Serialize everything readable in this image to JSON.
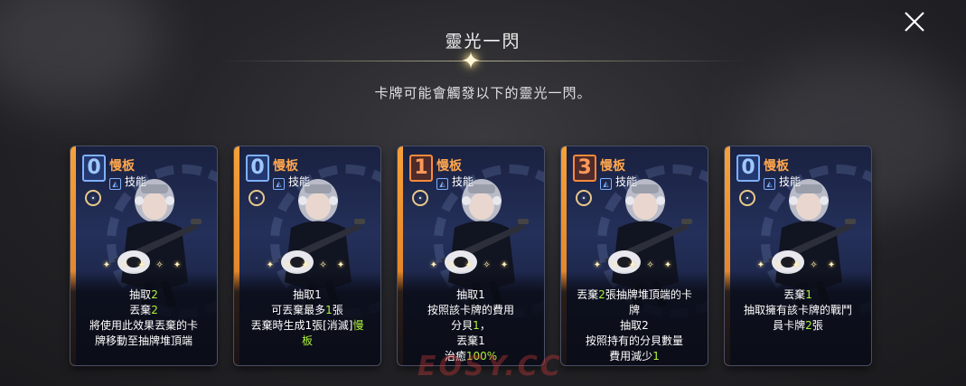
{
  "header": {
    "title": "靈光一閃",
    "subtitle": "卡牌可能會觸發以下的靈光一閃。"
  },
  "watermark": "EOSY.CC",
  "cards": [
    {
      "cost": "0",
      "cost_color": "blue",
      "name": "慢板",
      "type": "技能",
      "lines": [
        [
          {
            "t": "抽取"
          },
          {
            "t": "2",
            "n": true
          }
        ],
        [
          {
            "t": "丟棄"
          },
          {
            "t": "2",
            "n": true
          }
        ],
        [
          {
            "t": "將使用此效果丟棄的卡"
          }
        ],
        [
          {
            "t": "牌移動至抽牌堆頂端"
          }
        ]
      ]
    },
    {
      "cost": "0",
      "cost_color": "blue",
      "name": "慢板",
      "type": "技能",
      "lines": [
        [
          {
            "t": "抽取1"
          }
        ],
        [
          {
            "t": "可丟棄最多"
          },
          {
            "t": "1",
            "n": true
          },
          {
            "t": "張"
          }
        ],
        [
          {
            "t": "丟棄時生成1張[消滅]"
          },
          {
            "t": "慢",
            "n": true
          }
        ],
        [
          {
            "t": "板",
            "n": true
          }
        ]
      ]
    },
    {
      "cost": "1",
      "cost_color": "orange",
      "name": "慢板",
      "type": "技能",
      "lines": [
        [
          {
            "t": "抽取1"
          }
        ],
        [
          {
            "t": "按照該卡牌的費用"
          }
        ],
        [
          {
            "t": "分貝"
          },
          {
            "t": "1",
            "n": true
          },
          {
            "t": "，"
          }
        ],
        [
          {
            "t": "丟棄1"
          }
        ],
        [
          {
            "t": "治癒"
          },
          {
            "t": "100%",
            "n": true
          }
        ]
      ]
    },
    {
      "cost": "3",
      "cost_color": "orange",
      "name": "慢板",
      "type": "技能",
      "lines": [
        [
          {
            "t": "丟棄"
          },
          {
            "t": "2",
            "n": true
          },
          {
            "t": "張抽牌堆頂端的卡"
          }
        ],
        [
          {
            "t": "牌"
          }
        ],
        [
          {
            "t": "抽取2"
          }
        ],
        [
          {
            "t": "按照持有的分貝數量"
          }
        ],
        [
          {
            "t": "費用減少"
          },
          {
            "t": "1",
            "n": true
          }
        ]
      ]
    },
    {
      "cost": "0",
      "cost_color": "blue",
      "name": "慢板",
      "type": "技能",
      "lines": [
        [
          {
            "t": "丟棄"
          },
          {
            "t": "1",
            "n": true
          }
        ],
        [
          {
            "t": "抽取擁有該卡牌的戰鬥"
          }
        ],
        [
          {
            "t": "員卡牌"
          },
          {
            "t": "2",
            "n": true
          },
          {
            "t": "張"
          }
        ]
      ]
    }
  ]
}
